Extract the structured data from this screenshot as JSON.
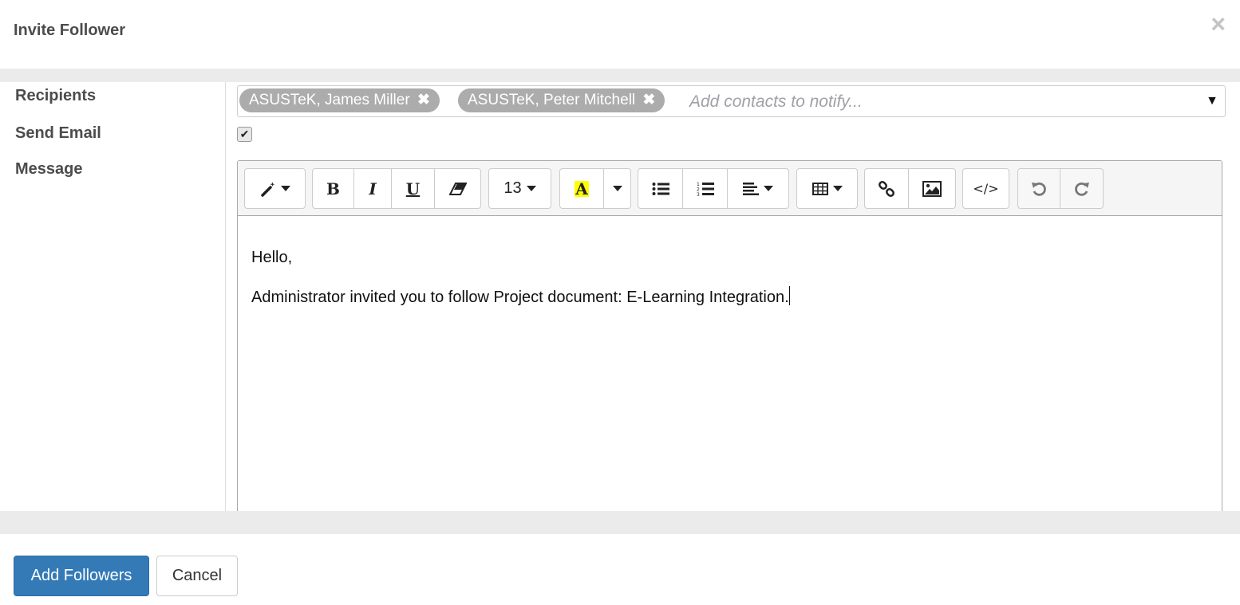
{
  "dialog": {
    "title": "Invite Follower",
    "close_icon": "close-icon"
  },
  "form": {
    "recipients_label": "Recipients",
    "send_email_label": "Send Email",
    "message_label": "Message",
    "recipients": [
      {
        "name": "ASUSTeK, James Miller",
        "remove": "✖"
      },
      {
        "name": "ASUSTeK, Peter Mitchell",
        "remove": "✖"
      }
    ],
    "recipients_placeholder": "Add contacts to notify...",
    "recipients_caret": "▼",
    "send_email_checked": true,
    "send_email_check": "✔"
  },
  "editor": {
    "toolbar": {
      "style_icon": "magic-wand-icon",
      "bold": "B",
      "italic": "I",
      "underline": "U",
      "eraser_icon": "eraser-icon",
      "font_size": "13",
      "color_letter": "A",
      "highlight_color": "#ffff00",
      "unordered_list_icon": "unordered-list-icon",
      "ordered_list_icon": "ordered-list-icon",
      "align_icon": "align-left-icon",
      "table_icon": "table-icon",
      "link_icon": "link-icon",
      "image_icon": "image-icon",
      "code_view": "</>",
      "undo_icon": "undo-icon",
      "redo_icon": "redo-icon"
    },
    "content": {
      "greeting": "Hello,",
      "body": "Administrator invited you to follow Project document: E-Learning Integration."
    }
  },
  "footer": {
    "primary_label": "Add Followers",
    "cancel_label": "Cancel",
    "primary_color": "#337ab7"
  }
}
